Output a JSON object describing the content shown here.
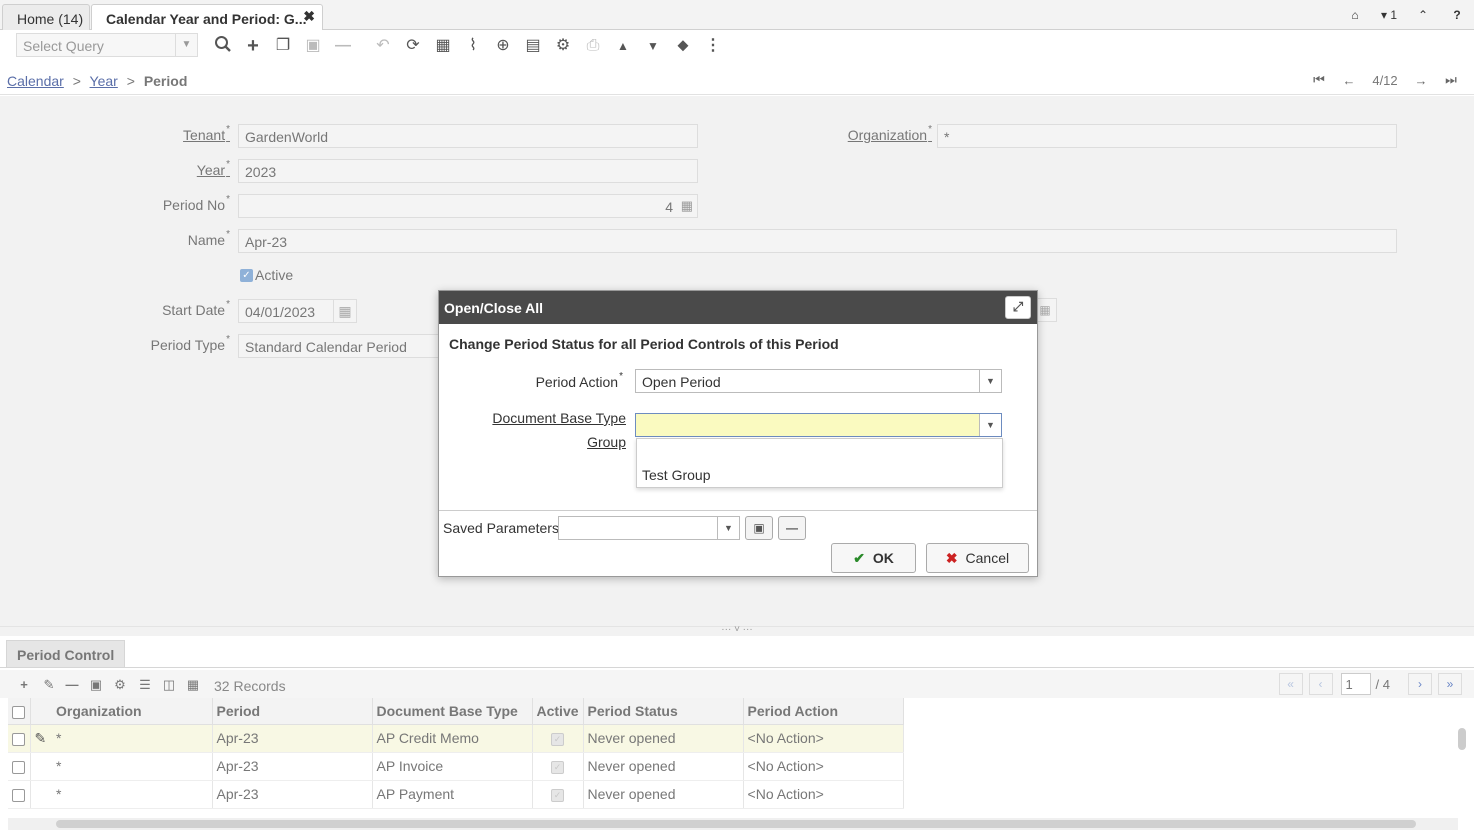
{
  "tabs": [
    {
      "label": "Home (14)"
    },
    {
      "label": "Calendar Year and Period: G..."
    }
  ],
  "top_right": {
    "home_icon": "⌂",
    "user_badge": "▾ 1",
    "collapse_icon": "⌃",
    "help_icon": "?"
  },
  "toolbar": {
    "select_query_placeholder": "Select Query"
  },
  "breadcrumb": {
    "calendar": "Calendar",
    "year": "Year",
    "period": "Period",
    "sep": ">"
  },
  "record_nav": {
    "position": "4/12"
  },
  "form": {
    "tenant_label": "Tenant",
    "tenant_value": "GardenWorld",
    "organization_label": "Organization",
    "organization_value": "*",
    "year_label": "Year",
    "year_value": "2023",
    "period_no_label": "Period No",
    "period_no_value": "4",
    "name_label": "Name",
    "name_value": "Apr-23",
    "active_label": "Active",
    "start_date_label": "Start Date",
    "start_date_value": "04/01/2023",
    "period_type_label": "Period Type",
    "period_type_value": "Standard Calendar Period",
    "required_mark": "*"
  },
  "dialog": {
    "title": "Open/Close All",
    "description": "Change Period Status for all Period Controls of this Period",
    "period_action_label": "Period Action",
    "period_action_value": "Open Period",
    "doc_base_type_label_line1": "Document Base Type",
    "doc_base_type_label_line2": "Group",
    "doc_base_type_value": "",
    "dropdown_options": [
      "",
      "Test Group"
    ],
    "saved_parameters_label": "Saved Parameters",
    "ok_label": "OK",
    "cancel_label": "Cancel"
  },
  "grid": {
    "tab_label": "Period Control",
    "record_count": "32 Records",
    "page_value": "1",
    "page_total": "/ 4",
    "columns": [
      "Organization",
      "Period",
      "Document Base Type",
      "Active",
      "Period Status",
      "Period Action"
    ],
    "rows": [
      {
        "org": "*",
        "period": "Apr-23",
        "doc_type": "AP Credit Memo",
        "status": "Never opened",
        "action": "<No Action>"
      },
      {
        "org": "*",
        "period": "Apr-23",
        "doc_type": "AP Invoice",
        "status": "Never opened",
        "action": "<No Action>"
      },
      {
        "org": "*",
        "period": "Apr-23",
        "doc_type": "AP Payment",
        "status": "Never opened",
        "action": "<No Action>"
      }
    ]
  },
  "colors": {
    "dialog_header": "#4a4a4a",
    "required_field": "#fafac0",
    "link": "#5a6ea8"
  }
}
